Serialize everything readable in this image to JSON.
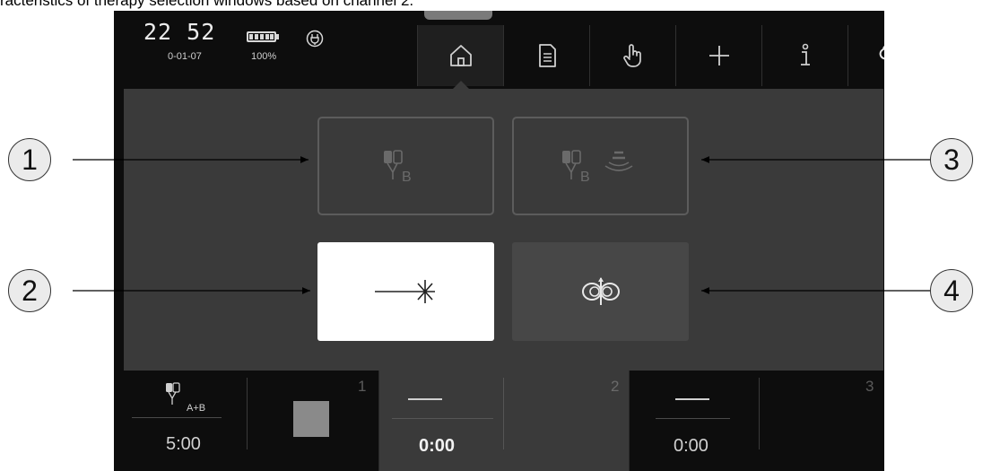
{
  "caption": "racteristics of therapy selection windows based on channel 2.",
  "status": {
    "time_hours": "22",
    "time_minutes": "52",
    "date": "0-01-07",
    "battery_percent": "100%",
    "battery_level": 1.0
  },
  "tabs": [
    {
      "icon": "home-icon",
      "active": true
    },
    {
      "icon": "document-icon",
      "active": false
    },
    {
      "icon": "hand-pointer-icon",
      "active": false
    },
    {
      "icon": "plus-icon",
      "active": false
    },
    {
      "icon": "info-icon",
      "active": false
    },
    {
      "icon": "wrench-icon",
      "active": false
    }
  ],
  "therapy_buttons": [
    {
      "icon": "electrode-b-icon",
      "sub": "B",
      "state": "disabled"
    },
    {
      "icon": "electrode-b-ultrasound-icon",
      "sub": "B",
      "state": "disabled"
    },
    {
      "icon": "laser-icon",
      "state": "selected"
    },
    {
      "icon": "magnetic-field-icon",
      "state": "available"
    }
  ],
  "channels": [
    {
      "number": "1",
      "mode": "A+B",
      "time": "5:00"
    },
    {
      "number": "2",
      "time": "0:00"
    },
    {
      "number": "3",
      "time": "0:00"
    }
  ],
  "callouts": [
    "1",
    "2",
    "3",
    "4"
  ],
  "colors": {
    "device_bg": "#0d0d0d",
    "panel_bg": "#3a3a3a",
    "selected_btn": "#ffffff",
    "callout_bg": "#ebebeb"
  }
}
